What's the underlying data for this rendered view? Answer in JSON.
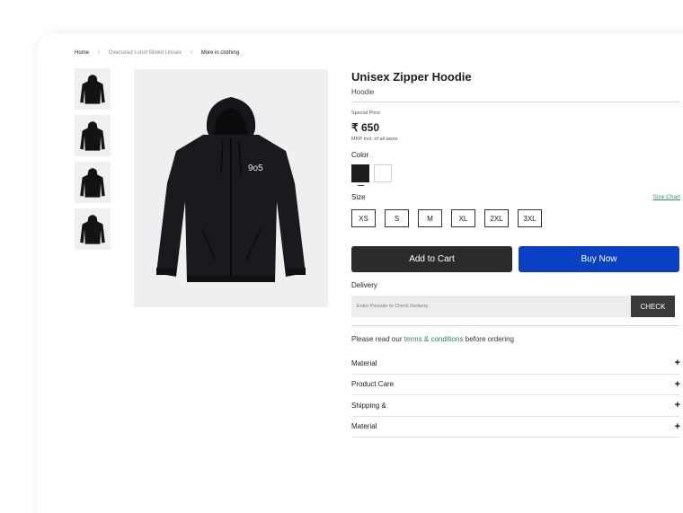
{
  "breadcrumb": {
    "home": "Home",
    "item2": "Oversized t-shirt Blinkit Unisex",
    "item3": "More in clothing",
    "separator": "/"
  },
  "product": {
    "title": "Unisex Zipper Hoodie",
    "subtitle": "Hoodie",
    "special_price_label": "Special Price",
    "price": "₹ 650",
    "mrp_note": "MRP Incl. of all taxes",
    "hoodie_logo": "9o5"
  },
  "color": {
    "label": "Color",
    "options": [
      "#1d1d22",
      "#ffffff"
    ]
  },
  "size": {
    "label": "Size",
    "chart_link": "Size Chart",
    "options": [
      "XS",
      "S",
      "M",
      "XL",
      "2XL",
      "3XL"
    ]
  },
  "actions": {
    "add_to_cart": "Add to Cart",
    "buy_now": "Buy Now"
  },
  "delivery": {
    "label": "Delivery",
    "placeholder": "Enter Pincode to Check Delivery",
    "check_label": "CHECK"
  },
  "terms": {
    "prefix": "Please read our ",
    "link": "terms & conditions",
    "suffix": " before ordering"
  },
  "accordion": [
    "Material",
    "Product Care",
    "Shipping &",
    "Material"
  ],
  "colors": {
    "cart_button": "#2b2b2b",
    "buy_button": "#0a40c4",
    "link_green": "#2e7d6a"
  }
}
